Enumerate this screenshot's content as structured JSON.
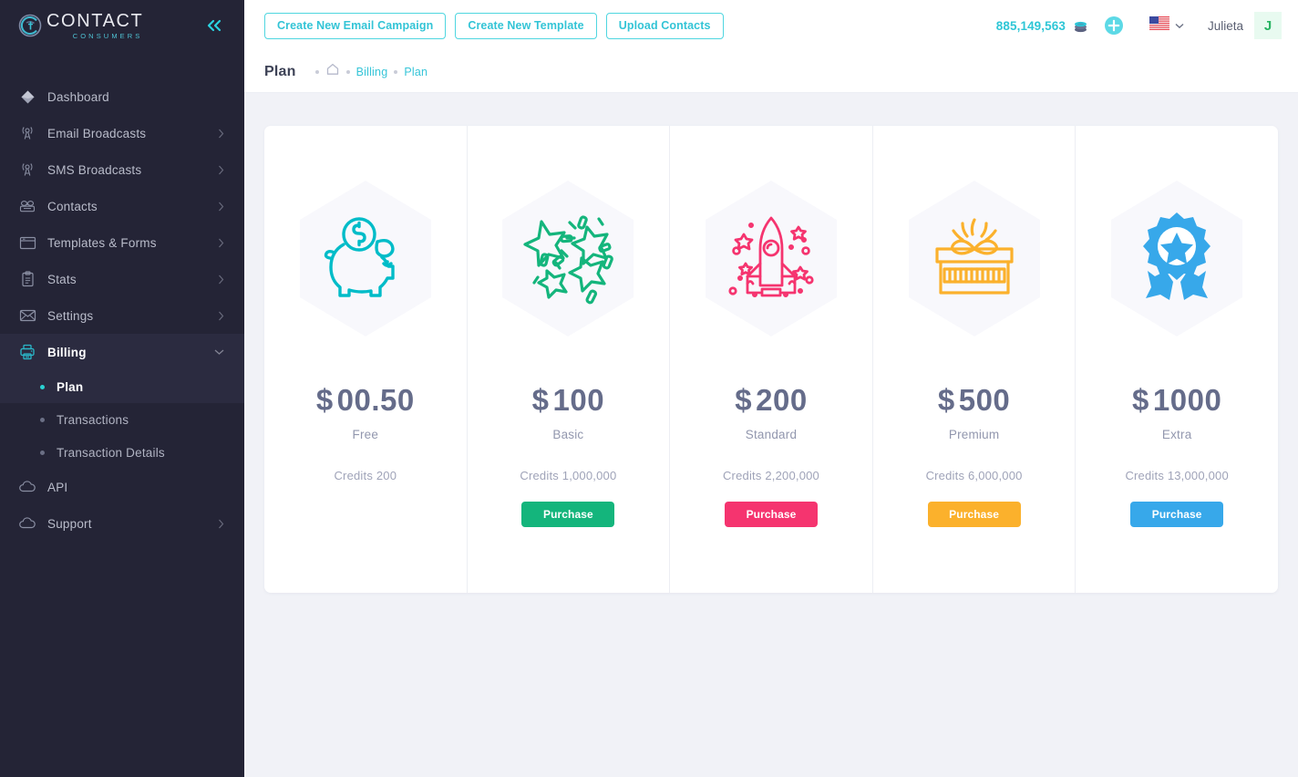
{
  "sidebar": {
    "logo": {
      "title": "CONTACT",
      "subtitle": "CONSUMERS",
      "icon": "contact-consumers-logo"
    },
    "collapse_icon": "double-chevron-left-icon",
    "items": [
      {
        "label": "Dashboard",
        "icon": "diamond-icon",
        "has_chevron": false,
        "active": false
      },
      {
        "label": "Email Broadcasts",
        "icon": "broadcast-tower-icon",
        "has_chevron": true,
        "active": false
      },
      {
        "label": "SMS Broadcasts",
        "icon": "broadcast-tower-icon",
        "has_chevron": true,
        "active": false
      },
      {
        "label": "Contacts",
        "icon": "telephone-icon",
        "has_chevron": true,
        "active": false
      },
      {
        "label": "Templates & Forms",
        "icon": "window-icon",
        "has_chevron": true,
        "active": false
      },
      {
        "label": "Stats",
        "icon": "clipboard-icon",
        "has_chevron": true,
        "active": false
      },
      {
        "label": "Settings",
        "icon": "envelope-icon",
        "has_chevron": true,
        "active": false
      },
      {
        "label": "Billing",
        "icon": "printer-icon",
        "has_chevron": true,
        "active": true,
        "expanded": true
      }
    ],
    "billing_submenu": [
      {
        "label": "Plan",
        "active": true
      },
      {
        "label": "Transactions",
        "active": false
      },
      {
        "label": "Transaction Details",
        "active": false
      }
    ],
    "items_after": [
      {
        "label": "API",
        "icon": "cloud-icon",
        "has_chevron": false,
        "active": false
      },
      {
        "label": "Support",
        "icon": "cloud-icon",
        "has_chevron": true,
        "active": false
      }
    ]
  },
  "topbar": {
    "buttons": [
      {
        "label": "Create New Email Campaign"
      },
      {
        "label": "Create New Template"
      },
      {
        "label": "Upload Contacts"
      }
    ],
    "credits": "885,149,563",
    "credits_icon": "coins-icon",
    "add_icon": "plus-circle-icon",
    "flag": "us-flag-icon",
    "flag_chevron": "chevron-down-icon",
    "user_name": "Julieta",
    "avatar_initial": "J"
  },
  "breadcrumb": {
    "title": "Plan",
    "home_icon": "home-icon",
    "links": [
      "Billing",
      "Plan"
    ]
  },
  "plans": [
    {
      "icon": "piggy-bank-icon",
      "currency": "$",
      "price": "00.50",
      "name": "Free",
      "credits": "Credits 200",
      "button_label": null,
      "color": "#00bcc8"
    },
    {
      "icon": "confetti-stars-icon",
      "currency": "$",
      "price": "100",
      "name": "Basic",
      "credits": "Credits 1,000,000",
      "button_label": "Purchase",
      "color": "#14b57c"
    },
    {
      "icon": "rocket-icon",
      "currency": "$",
      "price": "200",
      "name": "Standard",
      "credits": "Credits 2,200,000",
      "button_label": "Purchase",
      "color": "#f5346f"
    },
    {
      "icon": "gift-box-icon",
      "currency": "$",
      "price": "500",
      "name": "Premium",
      "credits": "Credits 6,000,000",
      "button_label": "Purchase",
      "color": "#fbb12c"
    },
    {
      "icon": "award-badge-icon",
      "currency": "$",
      "price": "1000",
      "name": "Extra",
      "credits": "Credits 13,000,000",
      "button_label": "Purchase",
      "color": "#37a8ea"
    }
  ],
  "colors": {
    "sidebar_bg": "#242436",
    "accent_teal": "#33c4d6",
    "page_bg": "#f1f2f7",
    "panel_bg": "#ffffff",
    "price_text": "#656c8a"
  }
}
